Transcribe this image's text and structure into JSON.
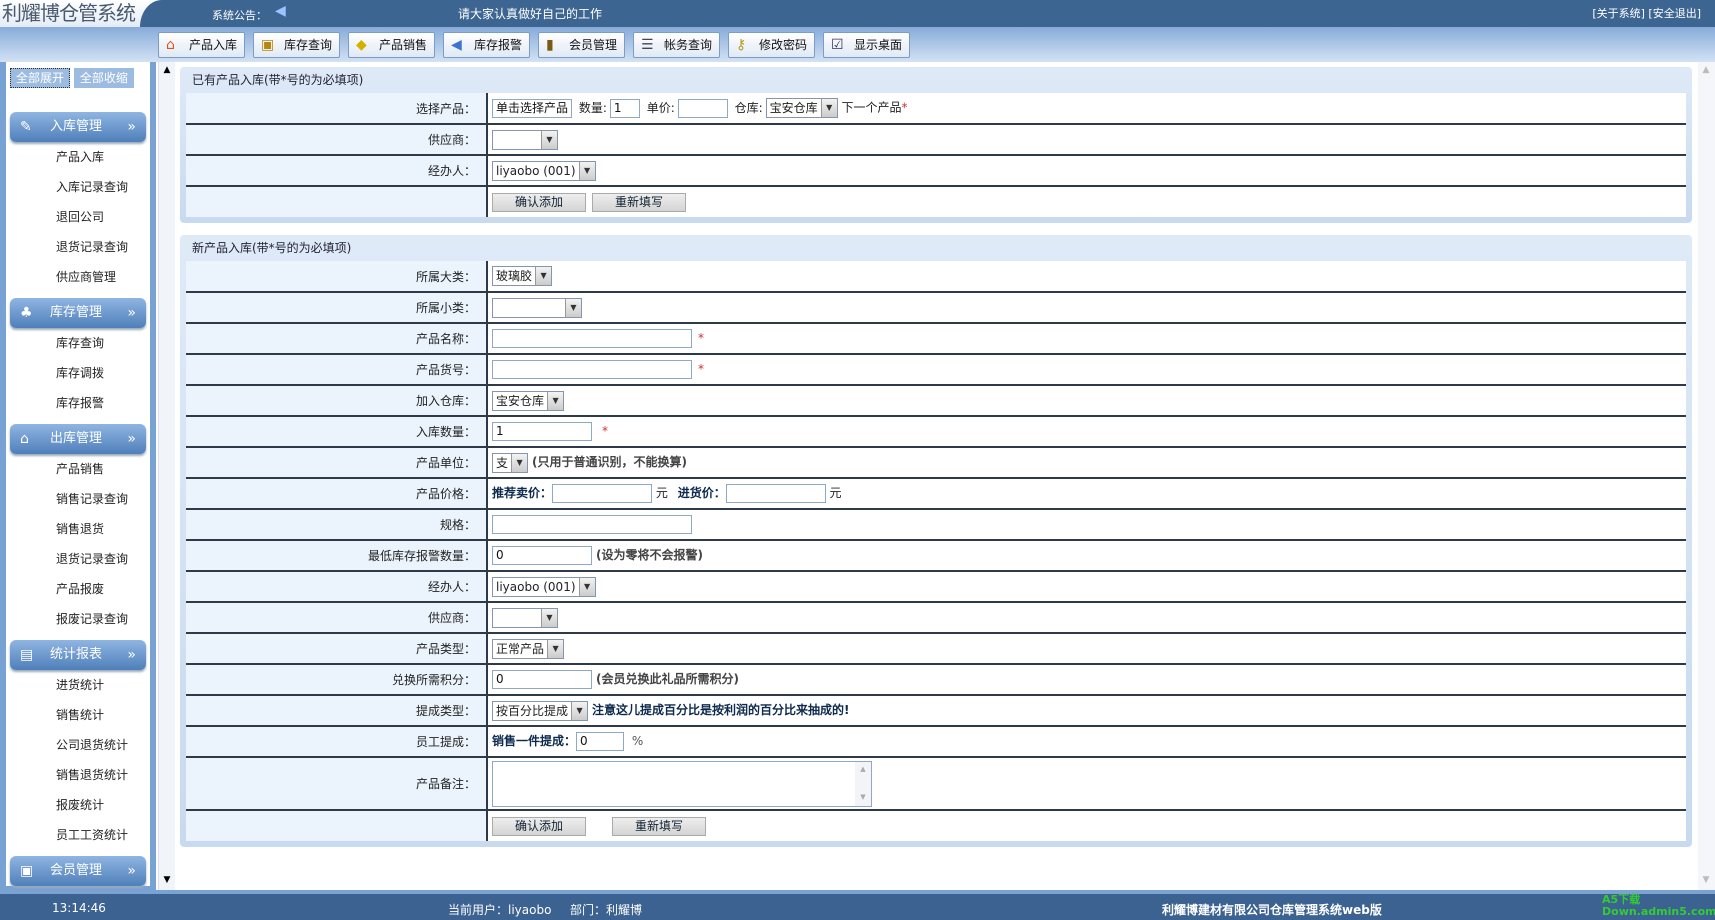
{
  "header": {
    "title": "利耀博仓管系统",
    "notice_label": "系统公告：",
    "notice_text": "请大家认真做好自己的工作",
    "links": [
      "[关于系统]",
      "[安全退出]"
    ]
  },
  "toolbar": [
    {
      "label": "产品入库",
      "icon": "house-icon"
    },
    {
      "label": "库存查询",
      "icon": "book-icon"
    },
    {
      "label": "产品销售",
      "icon": "tag-icon"
    },
    {
      "label": "库存报警",
      "icon": "speaker-icon"
    },
    {
      "label": "会员管理",
      "icon": "member-icon"
    },
    {
      "label": "帐务查询",
      "icon": "clipboard-icon"
    },
    {
      "label": "修改密码",
      "icon": "key-icon"
    },
    {
      "label": "显示桌面",
      "icon": "desktop-icon"
    }
  ],
  "sidebar": {
    "expand_all": "全部展开",
    "collapse_all": "全部收缩",
    "groups": [
      {
        "label": "入库管理",
        "items": [
          "产品入库",
          "入库记录查询",
          "退回公司",
          "退货记录查询",
          "供应商管理"
        ]
      },
      {
        "label": "库存管理",
        "items": [
          "库存查询",
          "库存调拨",
          "库存报警"
        ]
      },
      {
        "label": "出库管理",
        "items": [
          "产品销售",
          "销售记录查询",
          "销售退货",
          "退货记录查询",
          "产品报废",
          "报废记录查询"
        ]
      },
      {
        "label": "统计报表",
        "items": [
          "进货统计",
          "销售统计",
          "公司退货统计",
          "销售退货统计",
          "报废统计",
          "员工工资统计"
        ]
      },
      {
        "label": "会员管理",
        "items": []
      }
    ]
  },
  "existing": {
    "title": "已有产品入库(带*号的为必填项)",
    "select_product_label": "选择产品：",
    "select_product_btn": "单击选择产品",
    "qty_label": "数量:",
    "qty_value": "1",
    "price_label": "单价:",
    "price_value": "",
    "warehouse_label": "仓库:",
    "warehouse_value": "宝安仓库",
    "next_product": "下一个产品",
    "required_mark": "*",
    "supplier_label": "供应商：",
    "supplier_value": "",
    "handler_label": "经办人：",
    "handler_value": "liyaobo (001)",
    "confirm": "确认添加",
    "reset": "重新填写"
  },
  "newp": {
    "title": "新产品入库(带*号的为必填项)",
    "category_label": "所属大类：",
    "category_value": "玻璃胶",
    "subcategory_label": "所属小类：",
    "subcategory_value": "",
    "name_label": "产品名称：",
    "name_value": "",
    "code_label": "产品货号：",
    "code_value": "",
    "warehouse_label": "加入仓库：",
    "warehouse_value": "宝安仓库",
    "qty_label": "入库数量：",
    "qty_value": "1",
    "unit_label": "产品单位：",
    "unit_value": "支",
    "unit_hint": "(只用于普通识别，不能换算)",
    "price_label": "产品价格：",
    "sell_label": "推荐卖价：",
    "sell_value": "",
    "yuan": "元",
    "buy_label": "进货价：",
    "buy_value": "",
    "spec_label": "规格：",
    "spec_value": "",
    "minstock_label": "最低库存报警数量：",
    "minstock_value": "0",
    "minstock_hint": "(设为零将不会报警)",
    "handler_label": "经办人：",
    "handler_value": "liyaobo (001)",
    "supplier_label": "供应商：",
    "supplier_value": "",
    "type_label": "产品类型：",
    "type_value": "正常产品",
    "points_label": "兑换所需积分：",
    "points_value": "0",
    "points_hint": "(会员兑换此礼品所需积分)",
    "commtype_label": "提成类型：",
    "commtype_value": "按百分比提成",
    "commtype_hint": "注意这儿提成百分比是按利润的百分比来抽成的!",
    "staffcomm_label": "员工提成：",
    "staffcomm_prefix": "销售一件提成：",
    "staffcomm_value": "0",
    "percent": "%",
    "remark_label": "产品备注：",
    "remark_value": "",
    "confirm": "确认添加",
    "reset": "重新填写",
    "required_mark": "*"
  },
  "footer": {
    "time": "13:14:46",
    "user": "当前用户：liyaobo",
    "dept": "部门：利耀博",
    "company": "利耀博建材有限公司仓库管理系统web版",
    "watermark": "A5下载 Down.admin5.com"
  }
}
